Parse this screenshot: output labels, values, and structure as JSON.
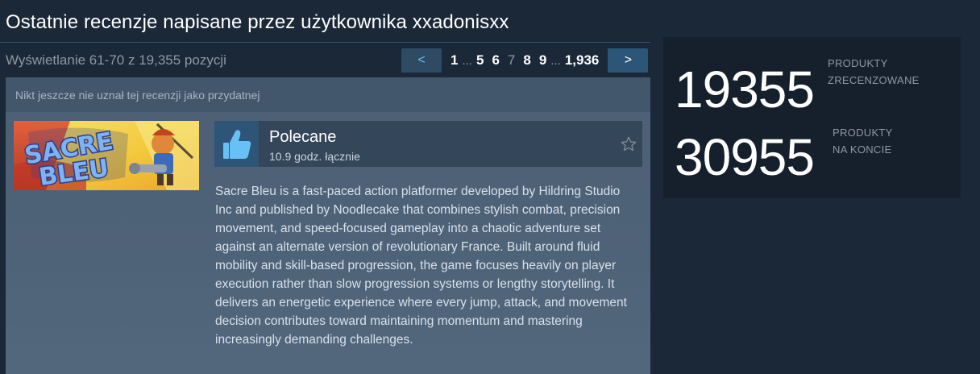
{
  "page": {
    "title": "Ostatnie recenzje napisane przez użytkownika xxadonisxx",
    "paging_info": "Wyświetlanie 61-70 z 19,355 pozycji"
  },
  "pager": {
    "prev_label": "<",
    "next_label": ">",
    "pages": [
      "1",
      "5",
      "6",
      "7",
      "8",
      "9",
      "1,936"
    ],
    "current_page": "7",
    "ellipsis": "..."
  },
  "review": {
    "helpful_text": "Nikt jeszcze nie uznał tej recenzji jako przydatnej",
    "game_logo_text": "SACRE BLEU",
    "recommendation": "Polecane",
    "hours": "10.9 godz. łącznie",
    "body": "Sacre Bleu is a fast-paced action platformer developed by Hildring Studio Inc and published by Noodlecake that combines stylish combat, precision movement, and speed-focused gameplay into a chaotic adventure set against an alternate version of revolutionary France. Built around fluid mobility and skill-based progression, the game focuses heavily on player execution rather than slow progression systems or lengthy storytelling. It delivers an energetic experience where every jump, attack, and movement decision contributes toward maintaining momentum and mastering increasingly demanding challenges."
  },
  "stats": {
    "reviewed_count": "19355",
    "reviewed_label_1": "PRODUKTY",
    "reviewed_label_2": "ZRECENZOWANE",
    "owned_count": "30955",
    "owned_label_1": "PRODUKTY",
    "owned_label_2": "NA KONCIE"
  },
  "colors": {
    "background": "#1b2838",
    "accent": "#66c0f4",
    "thumb_up": "#67c1f5"
  },
  "icons": [
    "thumbs-up-icon",
    "star-outline-icon"
  ]
}
